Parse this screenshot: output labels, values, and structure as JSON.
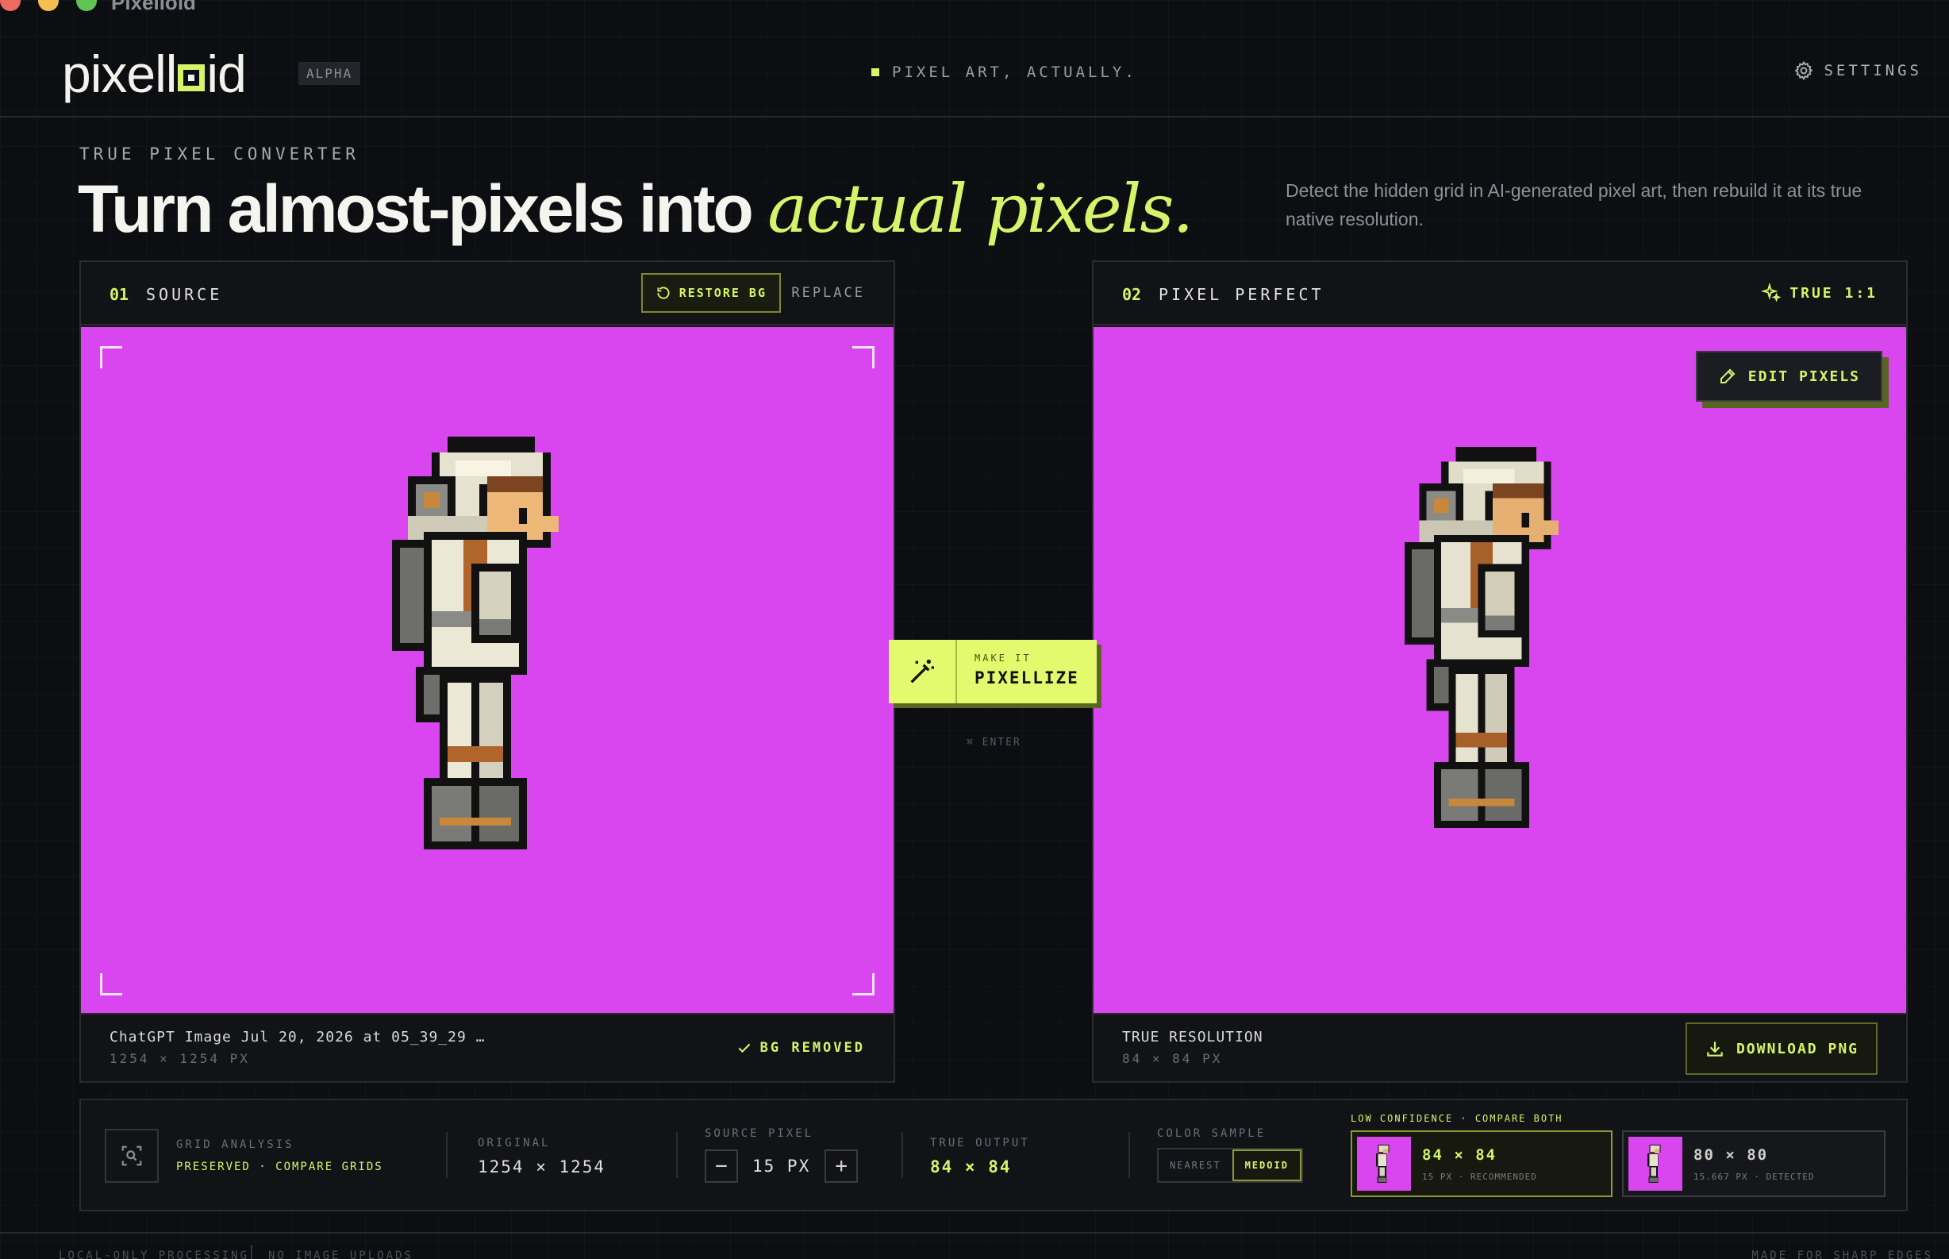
{
  "window": {
    "title": "Pixelloid"
  },
  "header": {
    "logo_left": "pixell",
    "logo_right": "id",
    "alpha_badge": "ALPHA",
    "tagline": "PIXEL ART, ACTUALLY.",
    "settings_label": "SETTINGS"
  },
  "hero": {
    "eyebrow": "TRUE PIXEL CONVERTER",
    "headline_plain": "Turn almost-pixels into ",
    "headline_accent": "actual pixels.",
    "description": "Detect the hidden grid in AI-generated pixel art, then rebuild it at its true native resolution."
  },
  "source_panel": {
    "number": "01",
    "title": "SOURCE",
    "restore_label": "RESTORE BG",
    "replace_label": "REPLACE",
    "file_name": "ChatGPT Image Jul 20, 2026 at 05_39_29 …",
    "dimensions": "1254 × 1254 PX",
    "status": "BG REMOVED"
  },
  "result_panel": {
    "number": "02",
    "title": "PIXEL PERFECT",
    "badge": "TRUE 1:1",
    "edit_label": "EDIT PIXELS",
    "resolution_label": "TRUE RESOLUTION",
    "dimensions": "84 × 84 PX",
    "download_label": "DOWNLOAD PNG"
  },
  "action": {
    "kicker": "MAKE IT",
    "label": "PIXELLIZE",
    "hint": "⌘ ENTER"
  },
  "analysis": {
    "grid_label": "GRID ANALYSIS",
    "grid_status": "PRESERVED · COMPARE GRIDS",
    "original_label": "ORIGINAL",
    "original_value": "1254 × 1254",
    "source_pixel_label": "SOURCE PIXEL",
    "source_pixel_value": "15 PX",
    "decrement": "−",
    "increment": "+",
    "true_output_label": "TRUE OUTPUT",
    "true_output_value": "84 × 84",
    "color_sample_label": "COLOR SAMPLE",
    "color_options": [
      "NEAREST",
      "MEDOID"
    ],
    "color_selected": "MEDOID",
    "confidence_label": "LOW CONFIDENCE · COMPARE BOTH",
    "candidates": [
      {
        "size": "84 × 84",
        "detail": "15 PX · RECOMMENDED",
        "selected": true
      },
      {
        "size": "80 × 80",
        "detail": "15.667 PX · DETECTED",
        "selected": false
      }
    ]
  },
  "footer": {
    "left_1": "LOCAL-ONLY PROCESSING",
    "left_2": "NO IMAGE UPLOADS",
    "right": "MADE FOR SHARP EDGES"
  },
  "colors": {
    "accent": "#d6f46a",
    "canvas_bg": "#d946ef",
    "page_bg": "#0d0e12"
  }
}
